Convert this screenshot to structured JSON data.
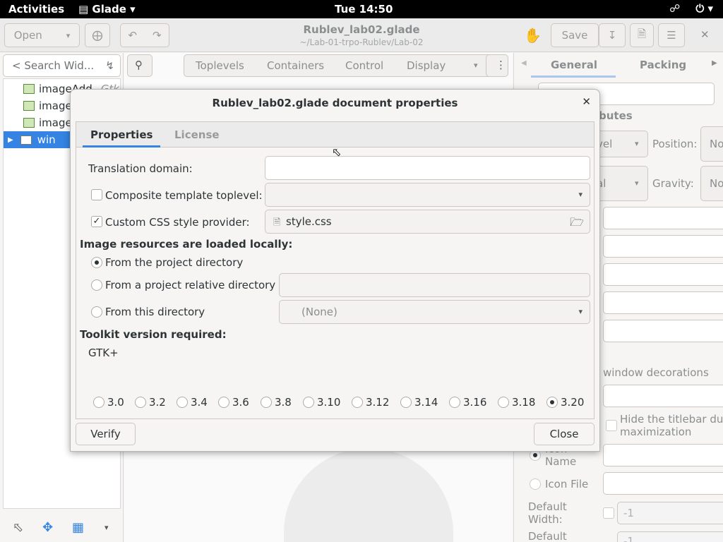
{
  "topbar": {
    "activities": "Activities",
    "app_name": "Glade",
    "clock": "Tue 14:50"
  },
  "headerbar": {
    "open_label": "Open",
    "title": "Rublev_lab02.glade",
    "subtitle": "~/Lab-01-trpo-Rublev/Lab-02",
    "save_label": "Save"
  },
  "palette": {
    "search_placeholder": "< Search Wid...",
    "tabs": [
      "Toplevels",
      "Containers",
      "Control",
      "Display"
    ]
  },
  "tree": {
    "items": [
      {
        "name": "imageAdd",
        "type": "Gtk"
      },
      {
        "name": "image",
        "type": ""
      },
      {
        "name": "image",
        "type": ""
      },
      {
        "name": "win",
        "type": ""
      }
    ]
  },
  "inspector": {
    "tabs": [
      "General",
      "Packing"
    ],
    "section_fragment": "butes",
    "combo1_fragment": "vel",
    "combo2_fragment": "al",
    "position_label": "Position:",
    "position_value": "No",
    "gravity_label": "Gravity:",
    "gravity_value": "No",
    "window_decorations": "window decorations",
    "hide_titlebar": "Hide the titlebar dur",
    "maximization": "maximization",
    "icon_name_1": "Icon",
    "icon_name_2": "Name",
    "icon_file": "Icon File",
    "default_width_1": "Default",
    "default_width_2": "Width:",
    "default_width_value": "-1",
    "default_height_1": "Default",
    "default_height_value": "-1"
  },
  "dialog": {
    "title": "Rublev_lab02.glade document properties",
    "tabs": [
      "Properties",
      "License"
    ],
    "translation_domain_label": "Translation domain:",
    "translation_domain_value": "",
    "composite_label": "Composite template toplevel:",
    "composite_checked": false,
    "css_label": "Custom CSS style provider:",
    "css_checked": true,
    "css_file": "style.css",
    "images_heading": "Image resources are loaded locally:",
    "image_options": [
      "From the project directory",
      "From a project relative directory",
      "From this directory"
    ],
    "image_selected": 0,
    "directory_combo": "(None)",
    "toolkit_heading": "Toolkit version required:",
    "toolkit_name": "GTK+",
    "versions": [
      "3.0",
      "3.2",
      "3.4",
      "3.6",
      "3.8",
      "3.10",
      "3.12",
      "3.14",
      "3.16",
      "3.18",
      "3.20"
    ],
    "selected_version": "3.20",
    "verify_label": "Verify",
    "close_label": "Close"
  }
}
